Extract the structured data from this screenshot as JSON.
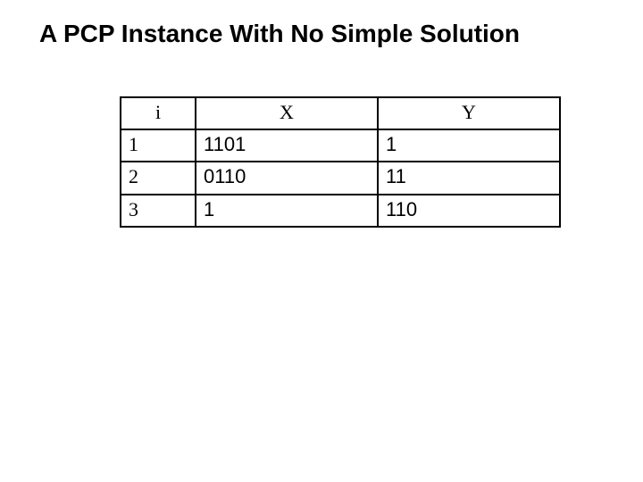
{
  "title": "A PCP Instance With No Simple Solution",
  "headers": {
    "i": "i",
    "x": "X",
    "y": "Y"
  },
  "rows": [
    {
      "i": "1",
      "x": "1101",
      "y": "1"
    },
    {
      "i": "2",
      "x": "0110",
      "y": "11"
    },
    {
      "i": "3",
      "x": "1",
      "y": "110"
    }
  ],
  "chart_data": {
    "type": "table",
    "title": "A PCP Instance With No Simple Solution",
    "columns": [
      "i",
      "X",
      "Y"
    ],
    "rows": [
      [
        "1",
        "1101",
        "1"
      ],
      [
        "2",
        "0110",
        "11"
      ],
      [
        "3",
        "1",
        "110"
      ]
    ]
  }
}
